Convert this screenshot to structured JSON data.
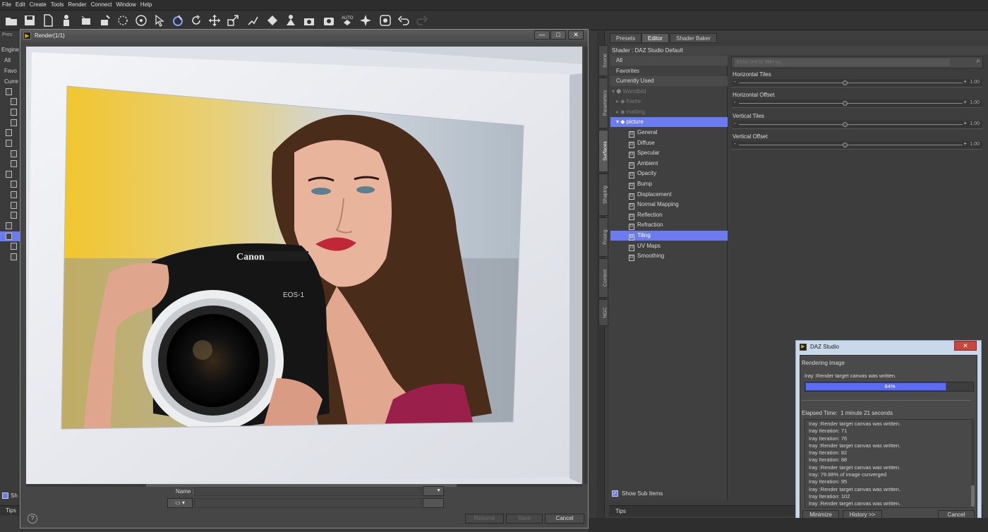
{
  "menu": [
    "File",
    "Edit",
    "Create",
    "Tools",
    "Render",
    "Connect",
    "Window",
    "Help"
  ],
  "left_panel": {
    "tab_partial": "Pres",
    "engine_label": "Engine",
    "rows": [
      "All",
      "Favo",
      "Curre"
    ],
    "show_checkbox_partial": "Sh",
    "tips_partial": "Tips"
  },
  "render_window": {
    "title": "Render(1/1)",
    "minimize": "—",
    "maximize": "□",
    "close": "✕",
    "name_label": "Name :",
    "name_value": "",
    "help": "?",
    "resume_label": "Resume",
    "save_label": "Save",
    "cancel_label": "Cancel"
  },
  "right_panel": {
    "tabs": [
      "Presets",
      "Editor",
      "Shader Baker"
    ],
    "active_tab": "Editor",
    "vertical_tabs": [
      "Scene",
      "Parameters",
      "Surfaces",
      "Shaping",
      "Posing",
      "Content",
      "NGC"
    ],
    "active_vertical_tab": "Surfaces",
    "shader_label": "Shader : DAZ Studio Default",
    "filter_placeholder": "Enter text to filter by...",
    "tree": {
      "all": "All",
      "favorites": "Favorites",
      "currently_used": "Currently Used",
      "root": "Wandbild",
      "children": [
        "frame",
        "matting",
        "picture"
      ],
      "surfaces": [
        "General",
        "Diffuse",
        "Specular",
        "Ambient",
        "Opacity",
        "Bump",
        "Displacement",
        "Normal Mapping",
        "Reflection",
        "Refraction",
        "Tiling",
        "UV Maps",
        "Smoothing"
      ],
      "selected_surface": "Tiling"
    },
    "properties": [
      {
        "label": "Horizontal Tiles",
        "value": "1.00",
        "slider": 0.5
      },
      {
        "label": "Horizontal Offset",
        "value": "1.00",
        "slider": 0.5
      },
      {
        "label": "Vertical Tiles",
        "value": "1.00",
        "slider": 0.5
      },
      {
        "label": "Vertical Offset",
        "value": "1.00",
        "slider": 0.5
      }
    ],
    "show_sub_items": "Show Sub Items",
    "tips": "Tips"
  },
  "progress_dialog": {
    "title": "DAZ Studio",
    "close": "✕",
    "status": "Rendering image",
    "message": "Iray :Render target canvas was written.",
    "progress": 84,
    "progress_text": "84%",
    "elapsed_label": "Elapsed Time:",
    "elapsed_value": "1 minute 21 seconds",
    "log": [
      "Iray :Render target canvas was written.",
      "Iray Iteration: 71",
      "Iray Iteration: 76",
      "Iray :Render target canvas was written.",
      "Iray Iteration: 82",
      "Iray Iteration: 88",
      "Iray :Render target canvas was written.",
      "Iray: 79.88% of image converged",
      "Iray Iteration: 95",
      "Iray :Render target canvas was written.",
      "Iray Iteration: 102",
      "Iray :Render target canvas was written."
    ],
    "minimize_label": "Minimize",
    "history_label": "History >>",
    "cancel_label": "Cancel"
  },
  "colors": {
    "selection": "#6b7cf0",
    "progress_fill": "#5a6cf0",
    "dialog_frame": "#c9d9ea"
  },
  "render_picture": {
    "brand_on_camera": "Canon",
    "model_on_camera": "EOS-1"
  }
}
